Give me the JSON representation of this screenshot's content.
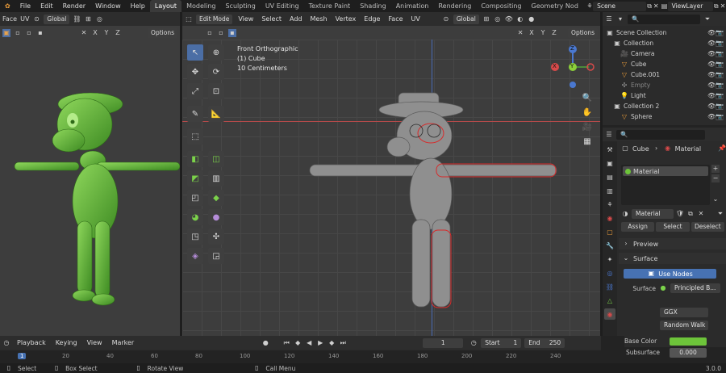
{
  "top_menu": {
    "items": [
      "File",
      "Edit",
      "Render",
      "Window",
      "Help"
    ],
    "workspaces": [
      "Layout",
      "Modeling",
      "Sculpting",
      "UV Editing",
      "Texture Paint",
      "Shading",
      "Animation",
      "Rendering",
      "Compositing",
      "Geometry Nod"
    ],
    "active_workspace": "Layout",
    "scene": "Scene",
    "view_layer": "ViewLayer"
  },
  "left_editor": {
    "header": {
      "mode": "Face",
      "uv": "UV",
      "transform": "Global"
    },
    "options": "Options"
  },
  "viewport": {
    "header": {
      "mode": "Edit Mode",
      "menus": [
        "View",
        "Select",
        "Add",
        "Mesh",
        "Vertex",
        "Edge",
        "Face",
        "UV"
      ],
      "transform": "Global"
    },
    "options": "Options",
    "overlay_text": {
      "line1": "Front Orthographic",
      "line2": "(1) Cube",
      "line3": "10 Centimeters"
    },
    "gizmo": {
      "x": "X",
      "y": "Y",
      "z": "Z"
    }
  },
  "outliner": {
    "items": [
      {
        "label": "Scene Collection",
        "indent": 0
      },
      {
        "label": "Collection",
        "indent": 1
      },
      {
        "label": "Camera",
        "indent": 2
      },
      {
        "label": "Cube",
        "indent": 2
      },
      {
        "label": "Cube.001",
        "indent": 2
      },
      {
        "label": "Empty",
        "indent": 2
      },
      {
        "label": "Light",
        "indent": 2
      },
      {
        "label": "Collection 2",
        "indent": 1
      },
      {
        "label": "Sphere",
        "indent": 2
      }
    ]
  },
  "properties": {
    "breadcrumb": {
      "object": "Cube",
      "material": "Material"
    },
    "slot": "Material",
    "material_name": "Material",
    "buttons": {
      "assign": "Assign",
      "select": "Select",
      "deselect": "Deselect"
    },
    "preview": "Preview",
    "surface_panel": "Surface",
    "use_nodes": "Use Nodes",
    "surface_label": "Surface",
    "surface_value": "Principled B...",
    "distribution": "GGX",
    "subsurface_method": "Random Walk",
    "base_color_label": "Base Color",
    "base_color": "#6dc43a",
    "subsurface_label": "Subsurface",
    "subsurface_value": "0.000"
  },
  "timeline": {
    "menus": [
      "Playback",
      "Keying",
      "View",
      "Marker"
    ],
    "current_frame": "1",
    "start_label": "Start",
    "start": "1",
    "end_label": "End",
    "end": "250",
    "ruler": [
      "1",
      "20",
      "40",
      "60",
      "80",
      "100",
      "120",
      "140",
      "160",
      "180",
      "200",
      "220",
      "240"
    ]
  },
  "status_bar": {
    "select": "Select",
    "box_select": "Box Select",
    "rotate": "Rotate View",
    "call_menu": "Call Menu",
    "version": "3.0.0"
  }
}
